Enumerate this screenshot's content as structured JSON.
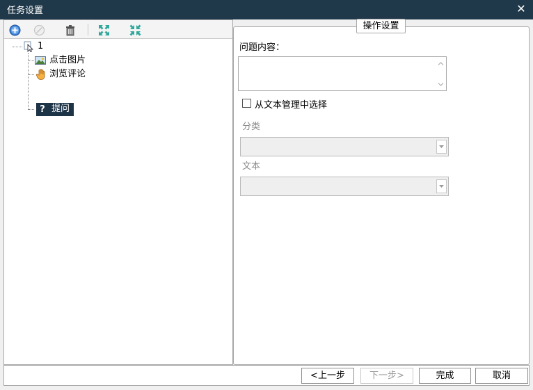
{
  "window": {
    "title": "任务设置",
    "close_glyph": "✕"
  },
  "toolbar": {
    "buttons": [
      {
        "name": "add-icon",
        "icon": "plus-circle"
      },
      {
        "name": "disable-icon",
        "icon": "prohibit-circle"
      },
      {
        "name": "delete-icon",
        "icon": "trash"
      },
      {
        "name": "expand-all-icon",
        "icon": "arrows-out"
      },
      {
        "name": "collapse-all-icon",
        "icon": "arrows-in"
      }
    ]
  },
  "tree": {
    "root": {
      "label": "1",
      "icon": "cursor-page"
    },
    "children": [
      {
        "label": "点击图片",
        "icon": "picture"
      },
      {
        "label": "浏览评论",
        "icon": "hand"
      },
      {
        "label": "提问",
        "icon": "question",
        "selected": true
      }
    ]
  },
  "settings": {
    "group_title": "操作设置",
    "question_label": "问题内容：",
    "question_value": "",
    "from_text_label": "从文本管理中选择",
    "from_text_checked": false,
    "category_label": "分类",
    "category_value": "",
    "text_label": "文本",
    "text_value": ""
  },
  "footer": {
    "prev": "<上一步",
    "next": "下一步>",
    "finish": "完成",
    "cancel": "取消"
  },
  "colors": {
    "titlebar": "#20394a",
    "selection": "#1d3447",
    "accent_green": "#2fa79a",
    "accent_blue": "#1f6fc4"
  }
}
